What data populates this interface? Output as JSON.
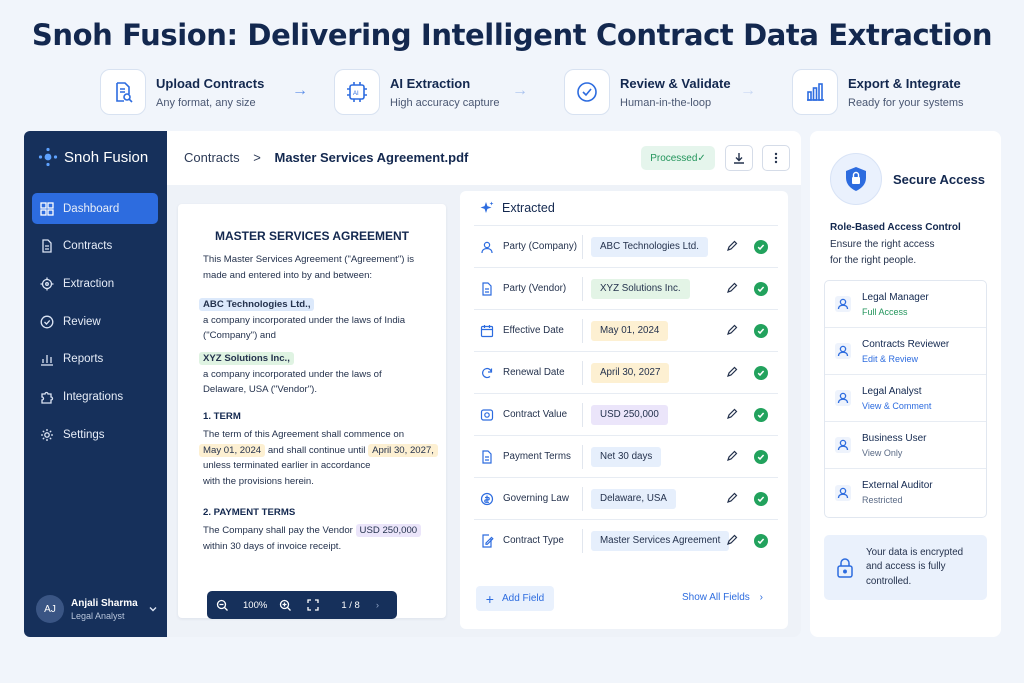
{
  "title": "Snoh Fusion: Delivering Intelligent Contract Data Extraction",
  "steps": [
    {
      "title": "Upload Contracts",
      "subtitle": "Any format, any size",
      "icon": "upload-doc-icon"
    },
    {
      "title": "AI Extraction",
      "subtitle": "High accuracy capture",
      "icon": "ai-chip-icon"
    },
    {
      "title": "Review & Validate",
      "subtitle": "Human-in-the-loop",
      "icon": "check-circle-icon"
    },
    {
      "title": "Export & Integrate",
      "subtitle": "Ready for your systems",
      "icon": "bar-chart-icon"
    }
  ],
  "sidebar": {
    "brand": "Snoh Fusion",
    "items": [
      {
        "label": "Dashboard",
        "icon": "grid-icon",
        "active": true
      },
      {
        "label": "Contracts",
        "icon": "document-icon"
      },
      {
        "label": "Extraction",
        "icon": "target-icon"
      },
      {
        "label": "Review",
        "icon": "check-circle-icon"
      },
      {
        "label": "Reports",
        "icon": "bar-chart-icon"
      },
      {
        "label": "Integrations",
        "icon": "puzzle-icon"
      },
      {
        "label": "Settings",
        "icon": "gear-icon"
      }
    ],
    "user": {
      "initials": "AJ",
      "name": "Anjali Sharma",
      "role": "Legal Analyst"
    }
  },
  "topbar": {
    "crumb_root": "Contracts",
    "crumb_sep": ">",
    "crumb_file": "Master Services Agreement.pdf",
    "status": "Processed✓"
  },
  "document": {
    "title": "MASTER SERVICES AGREEMENT",
    "intro_1": "This Master Services Agreement (\"Agreement\") is",
    "intro_2": "made and entered into by and between:",
    "party1": "ABC Technologies Ltd.,",
    "party1_d1": "a company incorporated under the laws of India",
    "party1_d2": "(\"Company\") and",
    "party2": "XYZ Solutions Inc.,",
    "party2_d1": "a company incorporated under the laws of",
    "party2_d2": "Delaware, USA (\"Vendor\").",
    "term_h": "1. TERM",
    "term_1": "The term of this Agreement shall commence on",
    "term_date1": "May 01, 2024",
    "term_mid": "and shall continue until",
    "term_date2": "April 30, 2027,",
    "term_3": "unless terminated earlier in accordance",
    "term_4": "with the provisions herein.",
    "pay_h": "2. PAYMENT TERMS",
    "pay_1": "The Company shall pay the Vendor",
    "pay_amount": "USD 250,000",
    "pay_2": "within 30 days of invoice receipt.",
    "viewer": {
      "zoom": "100%",
      "page": "1 / 8"
    }
  },
  "extracted": {
    "heading": "Extracted",
    "fields": [
      {
        "label": "Party (Company)",
        "value": "ABC Technologies Ltd.",
        "icon": "person-icon",
        "bg": "#e6effc"
      },
      {
        "label": "Party (Vendor)",
        "value": "XYZ Solutions Inc.",
        "icon": "document-icon",
        "bg": "#e3f4e6"
      },
      {
        "label": "Effective Date",
        "value": "May 01, 2024",
        "icon": "calendar-icon",
        "bg": "#fdf0d2"
      },
      {
        "label": "Renewal Date",
        "value": "April 30, 2027",
        "icon": "refresh-icon",
        "bg": "#fdf0d2"
      },
      {
        "label": "Contract Value",
        "value": "USD 250,000",
        "icon": "money-icon",
        "bg": "#ebe5fa"
      },
      {
        "label": "Payment Terms",
        "value": "Net 30 days",
        "icon": "document-icon",
        "bg": "#e6effc"
      },
      {
        "label": "Governing Law",
        "value": "Delaware, USA",
        "icon": "scale-icon",
        "bg": "#e6effc"
      },
      {
        "label": "Contract Type",
        "value": "Master Services Agreement",
        "icon": "edit-doc-icon",
        "bg": "#e6effc"
      }
    ],
    "add_field": "Add Field",
    "show_all": "Show All Fields"
  },
  "access": {
    "title": "Secure Access",
    "rbac_title": "Role-Based Access Control",
    "rbac_d1": "Ensure the right access",
    "rbac_d2": "for the right people.",
    "roles": [
      {
        "name": "Legal Manager",
        "perm": "Full Access",
        "color": "#23955c"
      },
      {
        "name": "Contracts Reviewer",
        "perm": "Edit & Review",
        "color": "#2d6cdf"
      },
      {
        "name": "Legal Analyst",
        "perm": "View & Comment",
        "color": "#2d6cdf"
      },
      {
        "name": "Business User",
        "perm": "View Only",
        "color": "#5b6b86"
      },
      {
        "name": "External Auditor",
        "perm": "Restricted",
        "color": "#5b6b86"
      }
    ],
    "enc_1": "Your data is encrypted",
    "enc_2": "and access is fully",
    "enc_3": "controlled."
  }
}
